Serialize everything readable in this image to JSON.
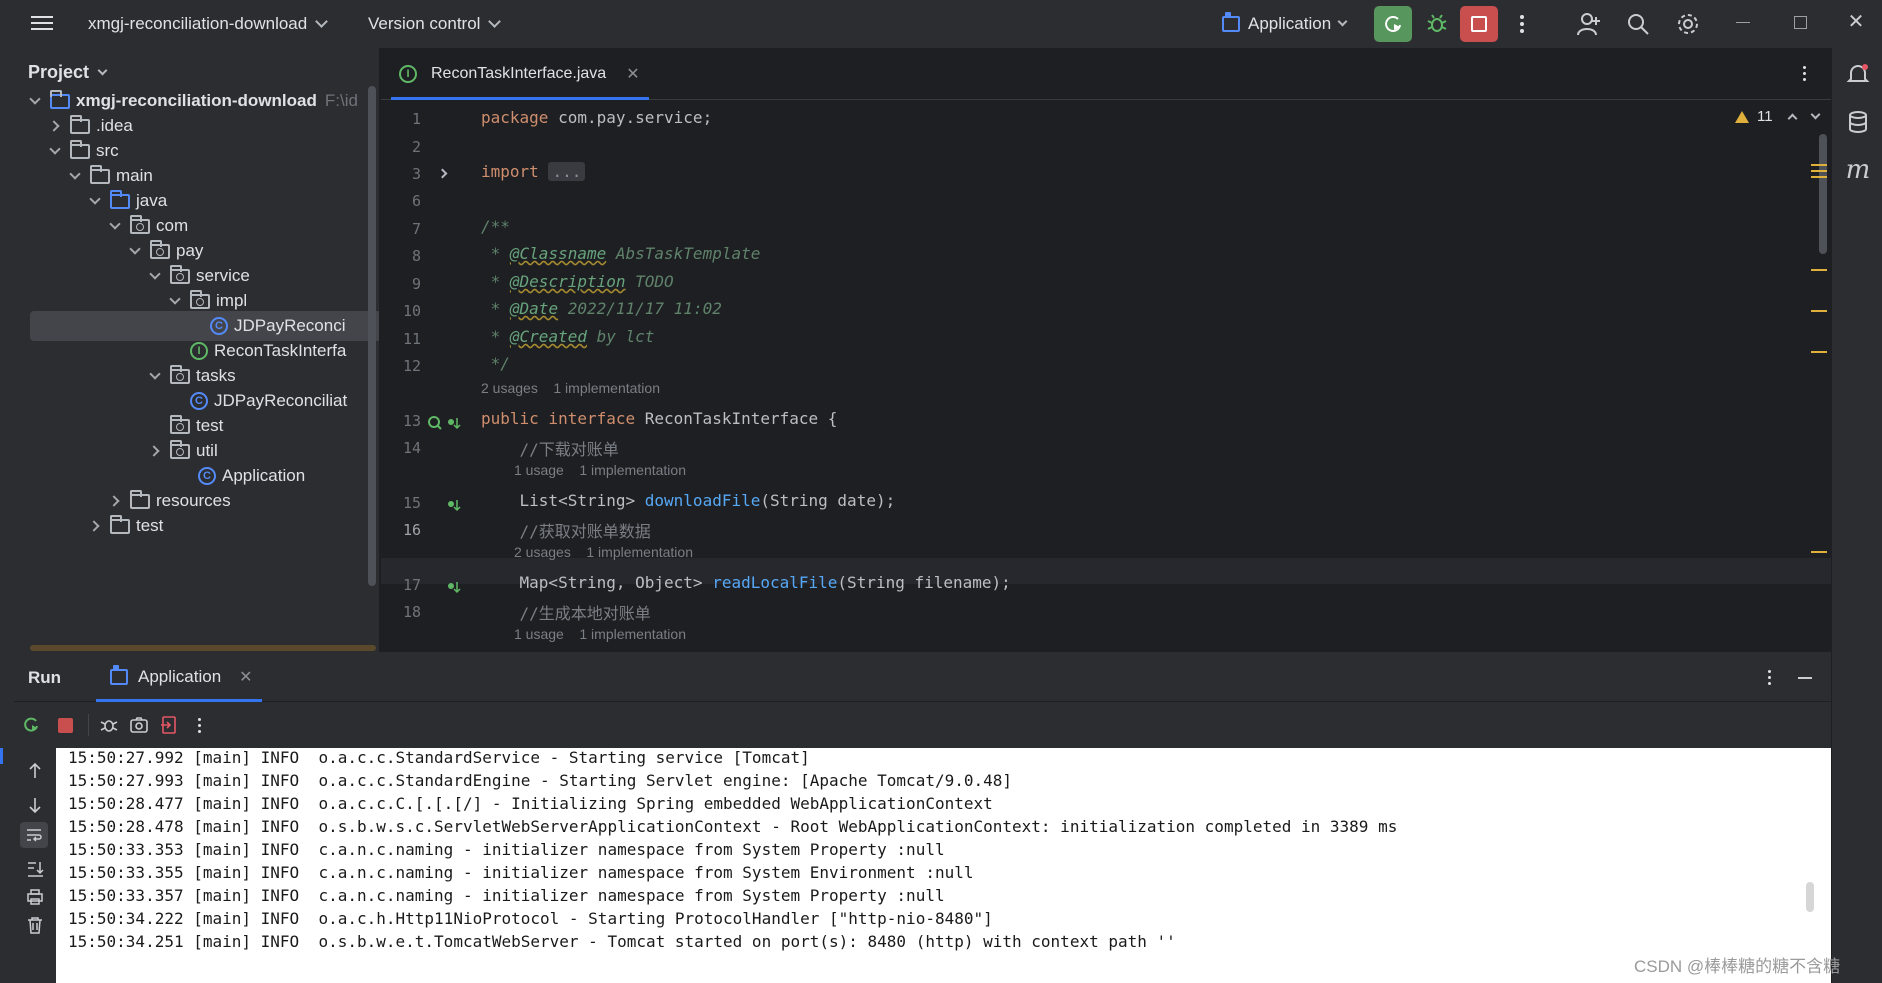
{
  "titlebar": {
    "project_name": "xmgj-reconciliation-download",
    "vcs_label": "Version control",
    "run_config": "Application"
  },
  "project_panel": {
    "title": "Project",
    "tree": [
      {
        "label": "xmgj-reconciliation-download",
        "path_hint": "F:\\id",
        "depth": 0,
        "expanded": true,
        "kind": "module"
      },
      {
        "label": ".idea",
        "depth": 1,
        "expanded": false,
        "kind": "folder"
      },
      {
        "label": "src",
        "depth": 1,
        "expanded": true,
        "kind": "folder"
      },
      {
        "label": "main",
        "depth": 2,
        "expanded": true,
        "kind": "folder"
      },
      {
        "label": "java",
        "depth": 3,
        "expanded": true,
        "kind": "source"
      },
      {
        "label": "com",
        "depth": 4,
        "expanded": true,
        "kind": "package"
      },
      {
        "label": "pay",
        "depth": 5,
        "expanded": true,
        "kind": "package"
      },
      {
        "label": "service",
        "depth": 6,
        "expanded": true,
        "kind": "package"
      },
      {
        "label": "impl",
        "depth": 7,
        "expanded": true,
        "kind": "package"
      },
      {
        "label": "JDPayReconci",
        "depth": 8,
        "kind": "class",
        "selected": true
      },
      {
        "label": "ReconTaskInterfa",
        "depth": 7,
        "kind": "interface"
      },
      {
        "label": "tasks",
        "depth": 6,
        "expanded": true,
        "kind": "package"
      },
      {
        "label": "JDPayReconciliat",
        "depth": 7,
        "kind": "class"
      },
      {
        "label": "test",
        "depth": 6,
        "kind": "package"
      },
      {
        "label": "util",
        "depth": 6,
        "expanded": false,
        "kind": "package"
      },
      {
        "label": "Application",
        "depth": 6,
        "kind": "app"
      },
      {
        "label": "resources",
        "depth": 3,
        "expanded": false,
        "kind": "folder"
      },
      {
        "label": "test",
        "depth": 2,
        "expanded": false,
        "kind": "folder"
      }
    ]
  },
  "editor": {
    "tab_label": "ReconTaskInterface.java",
    "warning_count": "11",
    "line_numbers": [
      "1",
      "2",
      "3",
      "6",
      "7",
      "8",
      "9",
      "10",
      "11",
      "12",
      "13",
      "14",
      "15",
      "16",
      "17",
      "18"
    ],
    "code": {
      "l1_kw": "package",
      "l1_rest": " com.pay.service;",
      "l3_kw": "import",
      "l3_fold": "...",
      "l7": "/**",
      "l8_star": " * ",
      "l8_tag": "@Classname",
      "l8_rest": " AbsTaskTemplate",
      "l9_star": " * ",
      "l9_tag": "@Description",
      "l9_rest": " TODO",
      "l10_star": " * ",
      "l10_tag": "@Date",
      "l10_rest": " 2022/11/17 11:02",
      "l11_star": " * ",
      "l11_tag": "@Created",
      "l11_rest": " by lct",
      "l12": " */",
      "hint13": "2 usages    1 implementation",
      "l13_kw": "public interface",
      "l13_rest": " ReconTaskInterface {",
      "l14": "    //下载对账单",
      "hint15": "1 usage    1 implementation",
      "l15_pre": "    List<String> ",
      "l15_fn": "downloadFile",
      "l15_post": "(String date);",
      "l16": "    //获取对账单数据",
      "hint17": "2 usages    1 implementation",
      "l17_pre": "    Map<String, Object> ",
      "l17_fn": "readLocalFile",
      "l17_post": "(String filename);",
      "l18": "    //生成本地对账单",
      "hint19": "1 usage    1 implementation"
    }
  },
  "run_panel": {
    "title": "Run",
    "tab_label": "Application",
    "console_lines": [
      "15:50:27.992 [main] INFO  o.a.c.c.StandardService - Starting service [Tomcat]",
      "15:50:27.993 [main] INFO  o.a.c.c.StandardEngine - Starting Servlet engine: [Apache Tomcat/9.0.48]",
      "15:50:28.477 [main] INFO  o.a.c.c.C.[.[.[/] - Initializing Spring embedded WebApplicationContext",
      "15:50:28.478 [main] INFO  o.s.b.w.s.c.ServletWebServerApplicationContext - Root WebApplicationContext: initialization completed in 3389 ms",
      "15:50:33.353 [main] INFO  c.a.n.c.naming - initializer namespace from System Property :null",
      "15:50:33.355 [main] INFO  c.a.n.c.naming - initializer namespace from System Environment :null",
      "15:50:33.357 [main] INFO  c.a.n.c.naming - initializer namespace from System Property :null",
      "15:50:34.222 [main] INFO  o.a.c.h.Http11NioProtocol - Starting ProtocolHandler [\"http-nio-8480\"]",
      "15:50:34.251 [main] INFO  o.s.b.w.e.t.TomcatWebServer - Tomcat started on port(s): 8480 (http) with context path ''"
    ]
  },
  "watermark": "CSDN @棒棒糖的糖不含糖",
  "colors": {
    "accent": "#3574f0",
    "rerun_green": "#57965c",
    "stop_red": "#c94f4f",
    "keyword": "#cf8e6d",
    "function": "#56a8f5",
    "doc_comment": "#5f826b"
  }
}
